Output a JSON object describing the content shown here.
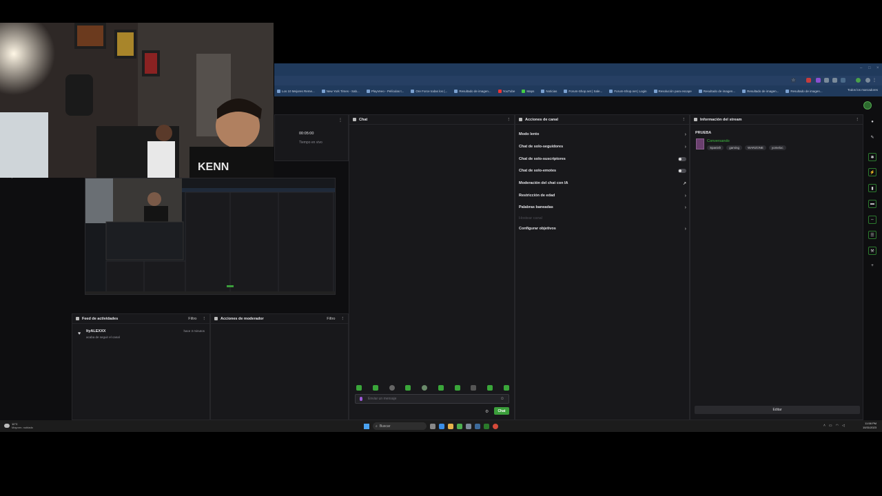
{
  "browser": {
    "bookmarks": [
      "Los 10 Mejores Reme...",
      "New York Times - Sab...",
      "PlayVeeo - Películas t...",
      "Ore Force todas los (...",
      "Resultado de imagen...",
      "YouTube",
      "Maps",
      "Noticias",
      "Forum-Shop.net | Sale...",
      "Forum-Shop.net | Login",
      "Resolución para escape",
      "Resultado de imagen...",
      "Resultado de imagen...",
      "Resultado de imagen..."
    ],
    "all_bookmarks": "Todos los marcadores"
  },
  "stats": {
    "timer": "00:05:00",
    "timer_label": "Tiempo en vivo"
  },
  "feed": {
    "title": "Feed de actividades",
    "filter": "Filtro",
    "items": [
      {
        "user": "ItyALEXXX",
        "message": "acaba de seguir el canal",
        "time": "hace 3 minutos"
      }
    ]
  },
  "mod_actions": {
    "title": "Acciones de moderador",
    "filter": "Filtro"
  },
  "chat": {
    "title": "Chat",
    "placeholder": "Enviar un mensaje",
    "send_label": "Chat"
  },
  "channel_actions": {
    "title": "Acciones de canal",
    "items": [
      {
        "label": "Modo lento",
        "control": "chevron"
      },
      {
        "label": "Chat de solo-seguidores",
        "control": "chevron"
      },
      {
        "label": "Chat de solo-suscriptores",
        "control": "toggle"
      },
      {
        "label": "Chat de solo-emotes",
        "control": "toggle"
      },
      {
        "label": "Moderación del chat con IA",
        "control": "external"
      },
      {
        "label": "Restricción de edad",
        "control": "chevron"
      },
      {
        "label": "Palabras baneadas",
        "control": "chevron"
      },
      {
        "label": "Hostear canal",
        "control": "disabled"
      },
      {
        "label": "Configurar objetivos",
        "control": "chevron"
      }
    ]
  },
  "stream_info": {
    "title": "Información del stream",
    "stream_title": "PRUEBA",
    "category": "Conversando",
    "tags": [
      "Spanish",
      "gaming",
      "WARZONE",
      "yomeloc"
    ],
    "edit_label": "Editar"
  },
  "camera": {
    "shirt_text": "KENN"
  },
  "sidebar_fragment": "Ajustes",
  "taskbar": {
    "weather_temp": "11°C",
    "weather_desc": "Mayorm. nublado",
    "search": "Buscar",
    "time": "11:58 PM",
    "date": "10/31/2023"
  },
  "colors": {
    "accent_green": "#3b9e3b",
    "bg": "#0e0e10",
    "panel": "#18181b",
    "chrome_blue": "#203a5c"
  }
}
